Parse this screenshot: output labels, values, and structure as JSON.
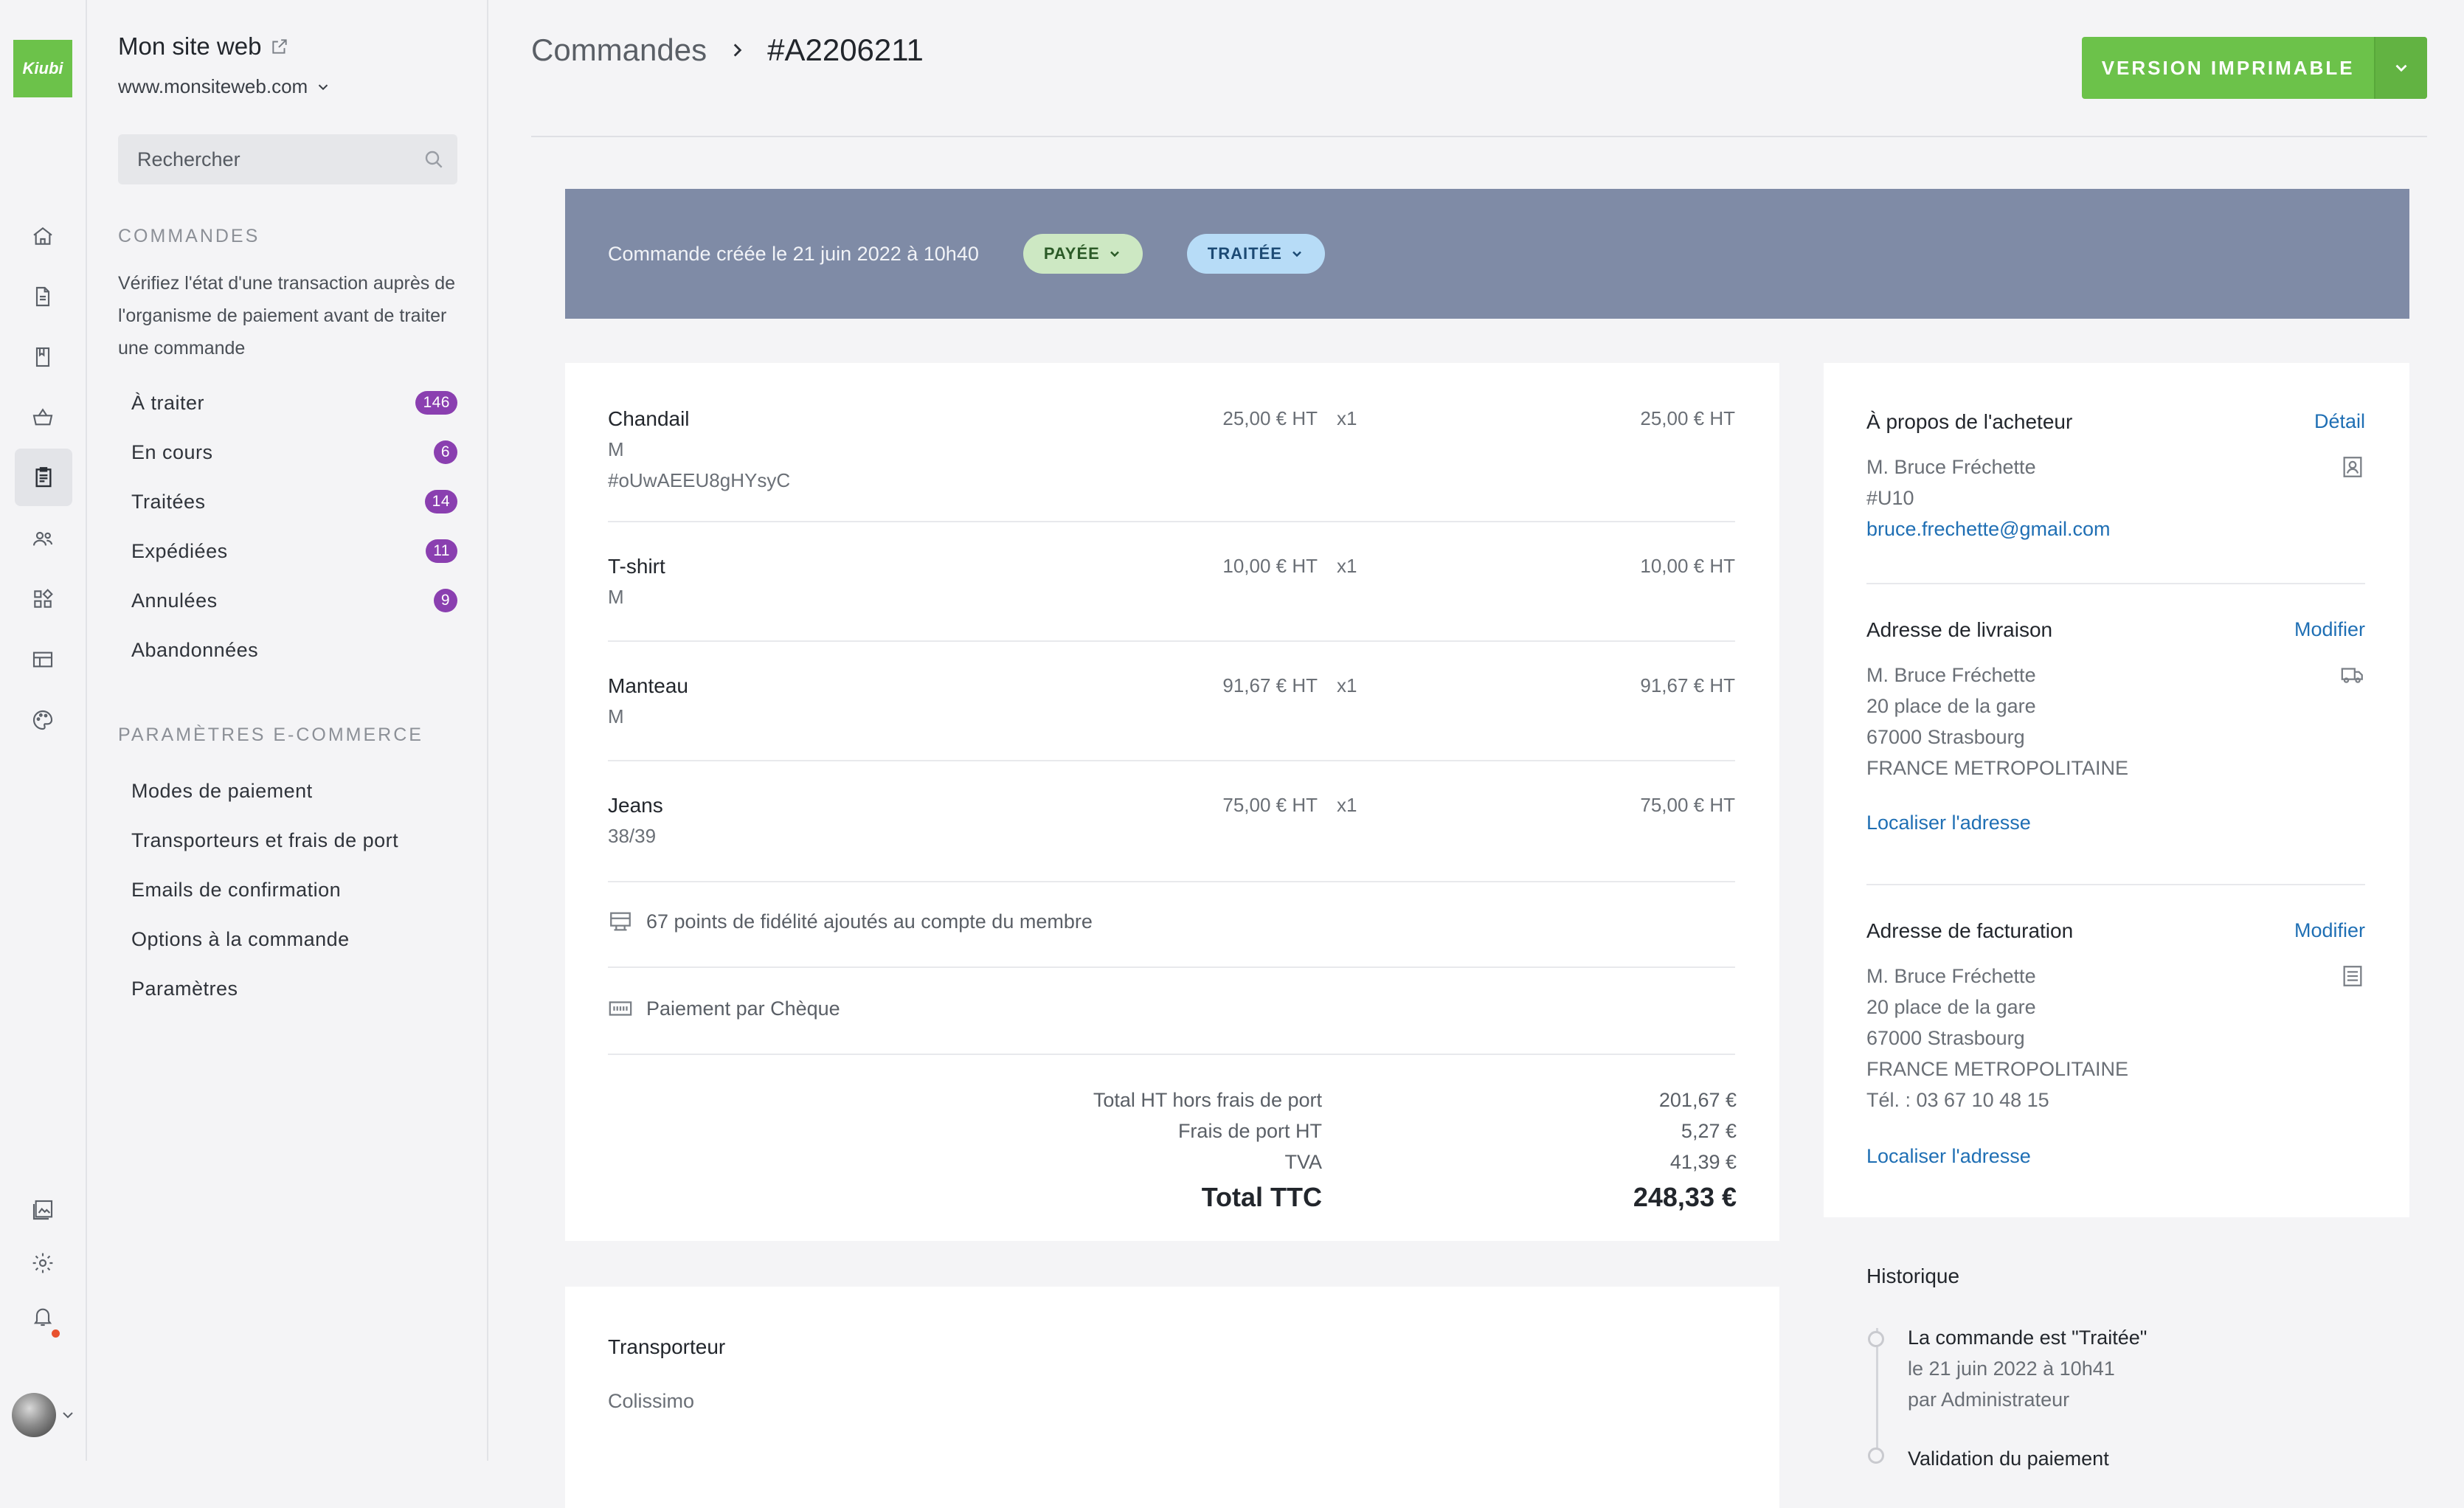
{
  "app": {
    "logo_text": "Kiubi",
    "brand_color": "#6cc24a",
    "site_name": "Mon site web",
    "site_url": "www.monsiteweb.com"
  },
  "rail": {
    "icons": [
      "home-icon",
      "document-icon",
      "book-icon",
      "basket-icon",
      "orders-icon",
      "users-icon",
      "widgets-icon",
      "layout-icon",
      "palette-icon",
      "media-icon",
      "gear-icon",
      "bell-icon"
    ],
    "active": "orders-icon"
  },
  "sidebar": {
    "search_placeholder": "Rechercher",
    "orders_heading": "COMMANDES",
    "orders_note": "Vérifiez l'état d'une transaction auprès de l'organisme de paiement avant de traiter une commande",
    "order_items": [
      {
        "label": "À traiter",
        "count": "146"
      },
      {
        "label": "En cours",
        "count": "6"
      },
      {
        "label": "Traitées",
        "count": "14"
      },
      {
        "label": "Expédiées",
        "count": "11"
      },
      {
        "label": "Annulées",
        "count": "9"
      },
      {
        "label": "Abandonnées",
        "count": ""
      }
    ],
    "ecommerce_heading": "PARAMÈTRES E-COMMERCE",
    "ecommerce_items": [
      {
        "label": "Modes de paiement"
      },
      {
        "label": "Transporteurs et frais de port"
      },
      {
        "label": "Emails de confirmation"
      },
      {
        "label": "Options à la commande"
      },
      {
        "label": "Paramètres"
      }
    ]
  },
  "header": {
    "breadcrumb_root": "Commandes",
    "breadcrumb_current": "#A2206211",
    "print_button": "VERSION IMPRIMABLE"
  },
  "banner": {
    "created_text": "Commande créée le 21 juin 2022 à 10h40",
    "payment_status": "PAYÉE",
    "order_status": "TRAITÉE",
    "background": "#7f8ba6"
  },
  "items": [
    {
      "name": "Chandail",
      "details": [
        "M",
        "#oUwAEEU8gHYsyC"
      ],
      "unit_price": "25,00 € HT",
      "qty": "x1",
      "total": "25,00 € HT"
    },
    {
      "name": "T-shirt",
      "details": [
        "M"
      ],
      "unit_price": "10,00 € HT",
      "qty": "x1",
      "total": "10,00 € HT"
    },
    {
      "name": "Manteau",
      "details": [
        "M"
      ],
      "unit_price": "91,67 € HT",
      "qty": "x1",
      "total": "91,67 € HT"
    },
    {
      "name": "Jeans",
      "details": [
        "38/39"
      ],
      "unit_price": "75,00 € HT",
      "qty": "x1",
      "total": "75,00 € HT"
    }
  ],
  "loyalty_text": "67 points de fidélité ajoutés au compte du membre",
  "payment_text": "Paiement par Chèque",
  "totals": [
    {
      "label": "Total HT hors frais de port",
      "value": "201,67 €"
    },
    {
      "label": "Frais de port HT",
      "value": "5,27 €"
    },
    {
      "label": "TVA",
      "value": "41,39 €"
    },
    {
      "label": "Total TTC",
      "value": "248,33 €"
    }
  ],
  "carrier": {
    "title": "Transporteur",
    "name": "Colissimo"
  },
  "buyer": {
    "title": "À propos de l'acheteur",
    "link": "Détail",
    "name": "M. Bruce Fréchette",
    "id": "#U10",
    "email": "bruce.frechette@gmail.com"
  },
  "shipping": {
    "title": "Adresse de livraison",
    "link": "Modifier",
    "lines": [
      "M. Bruce Fréchette",
      "20 place de la gare",
      "67000 Strasbourg",
      "FRANCE METROPOLITAINE"
    ],
    "locate": "Localiser l'adresse"
  },
  "billing": {
    "title": "Adresse de facturation",
    "link": "Modifier",
    "lines": [
      "M. Bruce Fréchette",
      "20 place de la gare",
      "67000 Strasbourg",
      "FRANCE METROPOLITAINE",
      "Tél. : 03 67 10 48 15"
    ],
    "locate": "Localiser l'adresse"
  },
  "history": {
    "title": "Historique",
    "events": [
      {
        "title": "La commande est \"Traitée\"",
        "date": "le 21 juin 2022 à 10h41",
        "by": "par Administrateur"
      },
      {
        "title": "Validation du paiement"
      }
    ]
  }
}
